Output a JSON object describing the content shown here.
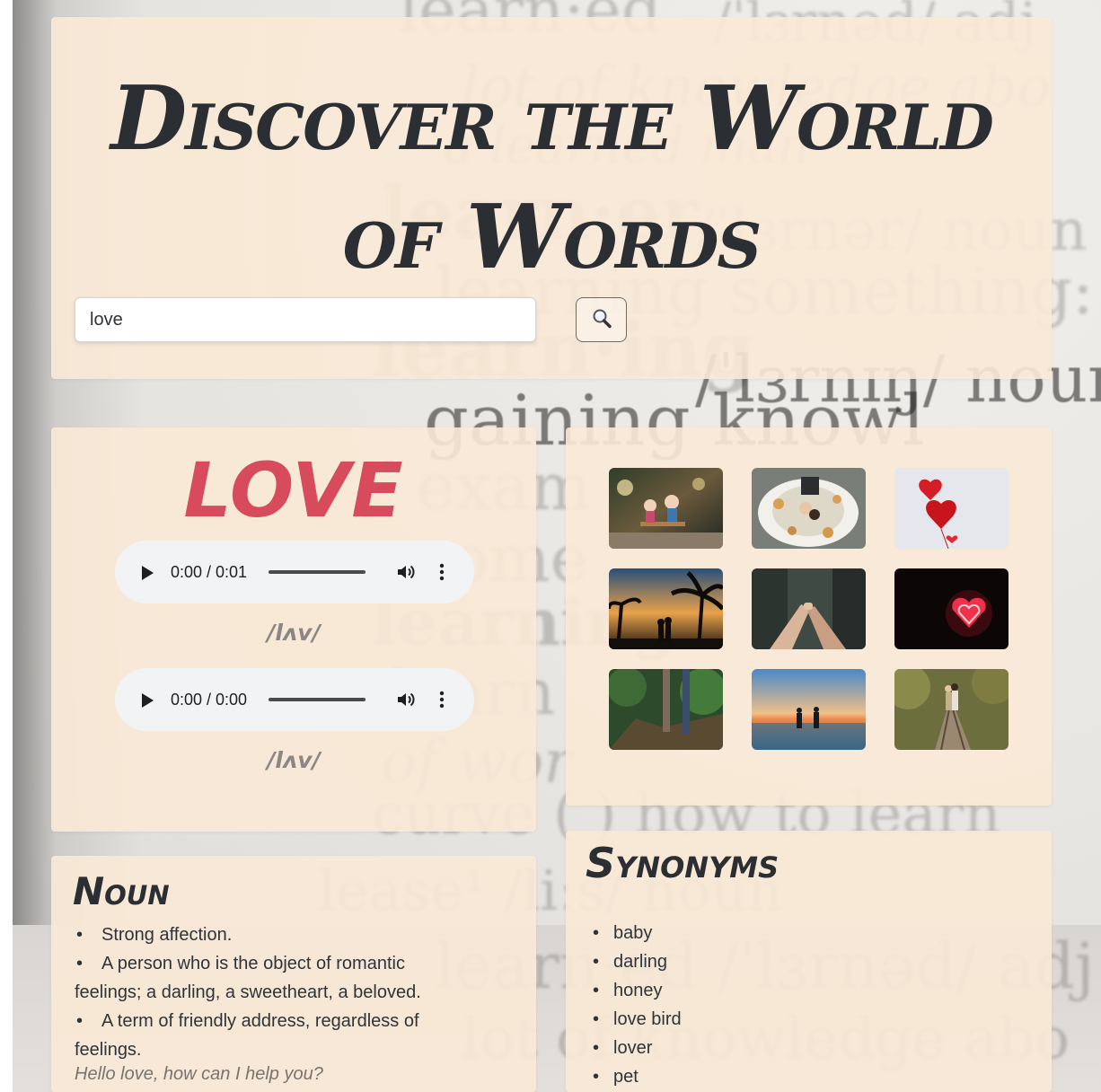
{
  "header": {
    "title": "Discover the World of Words",
    "search": {
      "value": "love",
      "button_icon": "magnifier-icon"
    }
  },
  "word": {
    "headword": "LOVE",
    "pronunciations": [
      {
        "audio_time": "0:00 / 0:01",
        "phonetic": "/lʌv/"
      },
      {
        "audio_time": "0:00 / 0:00",
        "phonetic": "/lʌv/"
      }
    ]
  },
  "images": [
    {
      "subject": "toy couple on bench"
    },
    {
      "subject": "bride and groom lying on petals"
    },
    {
      "subject": "red heart balloons"
    },
    {
      "subject": "couple silhouette under palm trees at sunset"
    },
    {
      "subject": "holding hands with pinkies"
    },
    {
      "subject": "red neon heart"
    },
    {
      "subject": "couple in forest"
    },
    {
      "subject": "couple walking on beach at sunset"
    },
    {
      "subject": "couple kissing on railway track"
    }
  ],
  "meaning": {
    "part_of_speech": "Noun",
    "definitions": [
      "Strong affection.",
      "A person who is the object of romantic feelings; a darling, a sweetheart, a beloved.",
      "A term of friendly address, regardless of feelings."
    ],
    "example": "Hello love, how can I help you?"
  },
  "synonyms": {
    "title": "Synonyms",
    "items": [
      "baby",
      "darling",
      "honey",
      "love bird",
      "lover",
      "pet"
    ]
  },
  "colors": {
    "card_bg": "#FAE9D6",
    "headword": "#D74B5C",
    "text": "#2F3338",
    "muted": "#8A8784"
  }
}
